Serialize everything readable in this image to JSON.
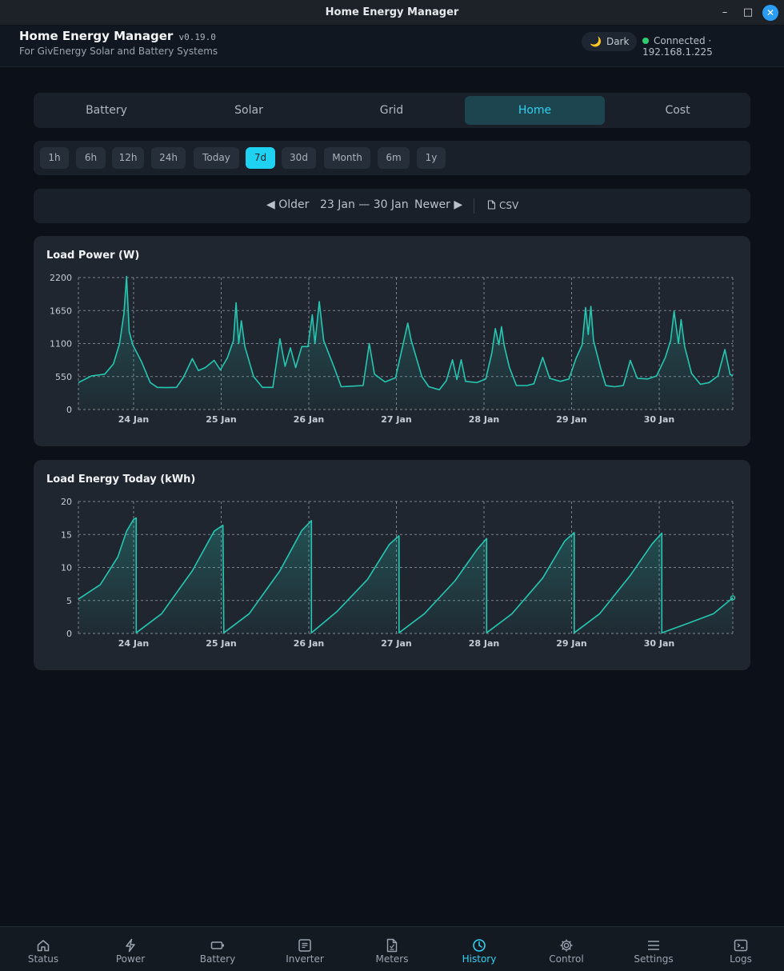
{
  "window": {
    "title": "Home Energy Manager",
    "minimize": "–",
    "maximize": "□",
    "close": "✕"
  },
  "header": {
    "title": "Home Energy Manager",
    "version": "v0.19.0",
    "subtitle": "For GivEnergy Solar and Battery Systems",
    "theme_label": "Dark",
    "theme_icon": "moon-icon",
    "connection": "Connected · 192.168.1.225",
    "connection_color": "#2ecc71"
  },
  "tabs": [
    {
      "label": "Battery",
      "active": false
    },
    {
      "label": "Solar",
      "active": false
    },
    {
      "label": "Grid",
      "active": false
    },
    {
      "label": "Home",
      "active": true
    },
    {
      "label": "Cost",
      "active": false
    }
  ],
  "ranges": [
    {
      "label": "1h",
      "active": false
    },
    {
      "label": "6h",
      "active": false
    },
    {
      "label": "12h",
      "active": false
    },
    {
      "label": "24h",
      "active": false
    },
    {
      "label": "Today",
      "active": false
    },
    {
      "label": "7d",
      "active": true
    },
    {
      "label": "30d",
      "active": false
    },
    {
      "label": "Month",
      "active": false
    },
    {
      "label": "6m",
      "active": false
    },
    {
      "label": "1y",
      "active": false
    }
  ],
  "navigator": {
    "older": "◀ Older",
    "range": "23 Jan — 30 Jan",
    "newer": "Newer ▶",
    "csv": "CSV"
  },
  "colors": {
    "accent": "#2fd1ef",
    "series": "#26c6b0",
    "background": "#0c1119",
    "card": "#202630"
  },
  "chart_data": [
    {
      "type": "area",
      "title": "Load Power (W)",
      "ylim": [
        0,
        2200
      ],
      "yticks": [
        "0",
        "550",
        "1100",
        "1650",
        "2200"
      ],
      "xticks": [
        "24 Jan",
        "25 Jan",
        "26 Jan",
        "27 Jan",
        "28 Jan",
        "29 Jan",
        "30 Jan"
      ],
      "grid": true,
      "series": [
        {
          "values": [
            [
              0,
              450
            ],
            [
              0.15,
              560
            ],
            [
              0.3,
              590
            ],
            [
              0.4,
              760
            ],
            [
              0.47,
              1100
            ],
            [
              0.52,
              1600
            ],
            [
              0.55,
              2220
            ],
            [
              0.58,
              1300
            ],
            [
              0.62,
              1080
            ],
            [
              0.72,
              800
            ],
            [
              0.82,
              450
            ],
            [
              0.9,
              370
            ],
            [
              1.0,
              365
            ],
            [
              1.12,
              370
            ],
            [
              1.2,
              540
            ],
            [
              1.3,
              850
            ],
            [
              1.37,
              650
            ],
            [
              1.45,
              700
            ],
            [
              1.55,
              820
            ],
            [
              1.62,
              660
            ],
            [
              1.7,
              860
            ],
            [
              1.77,
              1150
            ],
            [
              1.8,
              1780
            ],
            [
              1.83,
              1100
            ],
            [
              1.86,
              1480
            ],
            [
              1.9,
              1050
            ],
            [
              2.0,
              550
            ],
            [
              2.1,
              370
            ],
            [
              2.22,
              370
            ],
            [
              2.3,
              1180
            ],
            [
              2.36,
              720
            ],
            [
              2.42,
              1030
            ],
            [
              2.48,
              700
            ],
            [
              2.55,
              1050
            ],
            [
              2.62,
              1050
            ],
            [
              2.67,
              1580
            ],
            [
              2.7,
              1100
            ],
            [
              2.75,
              1800
            ],
            [
              2.8,
              1150
            ],
            [
              2.92,
              700
            ],
            [
              3.0,
              380
            ],
            [
              3.12,
              390
            ],
            [
              3.25,
              400
            ],
            [
              3.32,
              1100
            ],
            [
              3.38,
              590
            ],
            [
              3.5,
              460
            ],
            [
              3.62,
              530
            ],
            [
              3.7,
              1050
            ],
            [
              3.76,
              1440
            ],
            [
              3.8,
              1150
            ],
            [
              3.92,
              550
            ],
            [
              4.0,
              380
            ],
            [
              4.12,
              330
            ],
            [
              4.2,
              480
            ],
            [
              4.27,
              830
            ],
            [
              4.32,
              500
            ],
            [
              4.37,
              830
            ],
            [
              4.42,
              470
            ],
            [
              4.55,
              450
            ],
            [
              4.65,
              510
            ],
            [
              4.72,
              950
            ],
            [
              4.76,
              1350
            ],
            [
              4.8,
              1080
            ],
            [
              4.83,
              1380
            ],
            [
              4.86,
              1070
            ],
            [
              4.92,
              700
            ],
            [
              5.0,
              400
            ],
            [
              5.12,
              400
            ],
            [
              5.2,
              430
            ],
            [
              5.3,
              870
            ],
            [
              5.38,
              520
            ],
            [
              5.5,
              470
            ],
            [
              5.6,
              510
            ],
            [
              5.68,
              850
            ],
            [
              5.75,
              1080
            ],
            [
              5.79,
              1700
            ],
            [
              5.82,
              1250
            ],
            [
              5.85,
              1720
            ],
            [
              5.88,
              1150
            ],
            [
              5.96,
              700
            ],
            [
              6.02,
              400
            ],
            [
              6.12,
              380
            ],
            [
              6.22,
              400
            ],
            [
              6.3,
              820
            ],
            [
              6.38,
              520
            ],
            [
              6.5,
              510
            ],
            [
              6.6,
              560
            ],
            [
              6.7,
              870
            ],
            [
              6.76,
              1150
            ],
            [
              6.8,
              1640
            ],
            [
              6.85,
              1100
            ],
            [
              6.88,
              1500
            ],
            [
              6.92,
              1050
            ],
            [
              7.0,
              600
            ],
            [
              7.1,
              420
            ],
            [
              7.2,
              450
            ],
            [
              7.3,
              560
            ],
            [
              7.38,
              1000
            ],
            [
              7.44,
              580
            ],
            [
              7.47,
              570
            ]
          ]
        }
      ]
    },
    {
      "type": "area",
      "title": "Load Energy Today (kWh)",
      "ylim": [
        0,
        20
      ],
      "yticks": [
        "0",
        "5",
        "10",
        "15",
        "20"
      ],
      "xticks": [
        "24 Jan",
        "25 Jan",
        "26 Jan",
        "27 Jan",
        "28 Jan",
        "29 Jan",
        "30 Jan"
      ],
      "grid": true,
      "series": [
        {
          "values": [
            [
              0,
              5.2
            ],
            [
              0.25,
              7.4
            ],
            [
              0.45,
              11.6
            ],
            [
              0.55,
              15.5
            ],
            [
              0.63,
              17.3
            ],
            [
              0.66,
              17.5
            ],
            [
              0.66,
              0.1
            ],
            [
              0.95,
              3.0
            ],
            [
              1.3,
              9.5
            ],
            [
              1.55,
              15.5
            ],
            [
              1.65,
              16.4
            ],
            [
              1.66,
              0.1
            ],
            [
              1.95,
              3.0
            ],
            [
              2.3,
              9.5
            ],
            [
              2.55,
              15.6
            ],
            [
              2.66,
              17.1
            ],
            [
              2.66,
              0.1
            ],
            [
              2.95,
              3.3
            ],
            [
              3.3,
              8.2
            ],
            [
              3.55,
              13.5
            ],
            [
              3.66,
              14.8
            ],
            [
              3.66,
              0.1
            ],
            [
              3.95,
              3.0
            ],
            [
              4.3,
              8.0
            ],
            [
              4.55,
              12.7
            ],
            [
              4.66,
              14.4
            ],
            [
              4.66,
              0.1
            ],
            [
              4.95,
              3.0
            ],
            [
              5.3,
              8.4
            ],
            [
              5.55,
              14.0
            ],
            [
              5.66,
              15.3
            ],
            [
              5.66,
              0.1
            ],
            [
              5.95,
              3.0
            ],
            [
              6.3,
              8.8
            ],
            [
              6.55,
              13.6
            ],
            [
              6.66,
              15.2
            ],
            [
              6.66,
              0.1
            ],
            [
              6.95,
              1.5
            ],
            [
              7.25,
              3.0
            ],
            [
              7.47,
              5.4
            ]
          ]
        }
      ]
    }
  ],
  "bottom_nav": [
    {
      "label": "Status",
      "icon": "house-icon",
      "active": false
    },
    {
      "label": "Power",
      "icon": "bolt-icon",
      "active": false
    },
    {
      "label": "Battery",
      "icon": "battery-icon",
      "active": false
    },
    {
      "label": "Inverter",
      "icon": "inverter-icon",
      "active": false
    },
    {
      "label": "Meters",
      "icon": "meters-icon",
      "active": false
    },
    {
      "label": "History",
      "icon": "clock-icon",
      "active": true
    },
    {
      "label": "Control",
      "icon": "gear-icon",
      "active": false
    },
    {
      "label": "Settings",
      "icon": "menu-icon",
      "active": false
    },
    {
      "label": "Logs",
      "icon": "terminal-icon",
      "active": false
    }
  ]
}
